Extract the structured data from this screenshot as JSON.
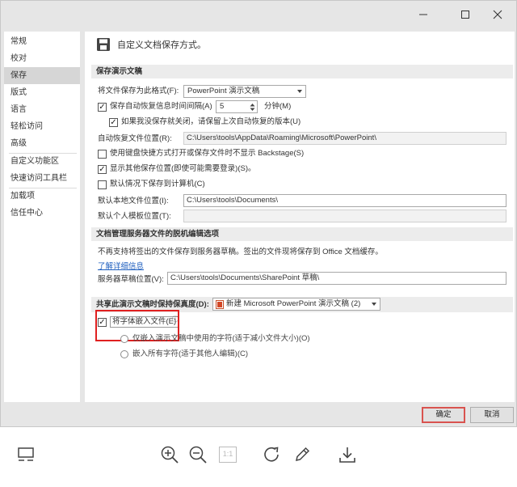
{
  "window": {
    "minimize_icon": "minimize-icon",
    "maximize_icon": "maximize-icon",
    "close_icon": "close-icon"
  },
  "sidebar": {
    "items": [
      {
        "label": "常规"
      },
      {
        "label": "校对"
      },
      {
        "label": "保存"
      },
      {
        "label": "版式"
      },
      {
        "label": "语言"
      },
      {
        "label": "轻松访问"
      },
      {
        "label": "高级"
      },
      {
        "label": "自定义功能区"
      },
      {
        "label": "快速访问工具栏"
      },
      {
        "label": "加载项"
      },
      {
        "label": "信任中心"
      }
    ],
    "active_index": 2
  },
  "main": {
    "heading": "自定义文档保存方式。",
    "save_section": {
      "title": "保存演示文稿",
      "format_label": "将文件保存为此格式(F):",
      "format_value": "PowerPoint 演示文稿",
      "autorecover_label": "保存自动恢复信息时间间隔(A)",
      "autorecover_checked": true,
      "autorecover_minutes": "5",
      "minutes_label": "分钟(M)",
      "keep_last_label": "如果我没保存就关闭，请保留上次自动恢复的版本(U)",
      "keep_last_checked": true,
      "autorecover_location_label": "自动恢复文件位置(R):",
      "autorecover_location_value": "C:\\Users\\tools\\AppData\\Roaming\\Microsoft\\PowerPoint\\",
      "backstage_label": "使用键盘快捷方式打开或保存文件时不显示 Backstage(S)",
      "backstage_checked": false,
      "show_other_label": "显示其他保存位置(即使可能需要登录)(S)。",
      "show_other_checked": true,
      "save_to_computer_label": "默认情况下保存到计算机(C)",
      "save_to_computer_checked": false,
      "default_local_label": "默认本地文件位置(I):",
      "default_local_value": "C:\\Users\\tools\\Documents\\",
      "default_template_label": "默认个人模板位置(T):",
      "default_template_value": ""
    },
    "offline_section": {
      "title": "文档管理服务器文件的脱机编辑选项",
      "note": "不再支持将签出的文件保存到服务器草稿。签出的文件现将保存到 Office 文档缓存。",
      "learn_more": "了解详细信息",
      "drafts_label": "服务器草稿位置(V):",
      "drafts_value": "C:\\Users\\tools\\Documents\\SharePoint 草稿\\"
    },
    "fidelity_section": {
      "title": "共享此演示文稿时保持保真度(D):",
      "doc_value": "新建 Microsoft PowerPoint 演示文稿 (2)",
      "embed_label": "将字体嵌入文件(E)",
      "embed_checked": true,
      "embed_info": "ⓘ",
      "option1_label": "仅嵌入演示文稿中使用的字符(适于减小文件大小)(O)",
      "option2_label": "嵌入所有字符(适于其他人编辑)(C)"
    }
  },
  "buttons": {
    "ok": "确定",
    "cancel": "取消"
  },
  "toolbar": {
    "icons": [
      "layout-icon",
      "zoom-in-icon",
      "zoom-out-icon",
      "actual-size-icon",
      "rotate-icon",
      "edit-icon",
      "download-icon"
    ],
    "actual_size_label": "1:1"
  },
  "colors": {
    "highlight_box": "#e02020",
    "ok_border": "#d9534f",
    "link": "#1f5fbf"
  }
}
